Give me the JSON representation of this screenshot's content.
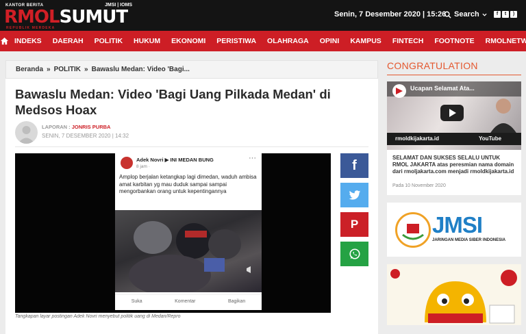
{
  "header": {
    "kantor_label": "KANTOR BERITA",
    "jmsi_label": "JMSI | IOMS",
    "logo_red": "RMOL",
    "logo_white": "SUMUT",
    "tagline": "REPUBLIK MERDEKA",
    "datetime": "Senin, 7 Desember 2020 | 15:26",
    "search_label": "Search"
  },
  "nav": {
    "items": [
      "INDEKS",
      "DAERAH",
      "POLITIK",
      "HUKUM",
      "EKONOMI",
      "PERISTIWA",
      "OLAHRAGA",
      "OPINI",
      "KAMPUS",
      "FINTECH",
      "FOOTNOTE",
      "RMOLNETWORK"
    ]
  },
  "breadcrumb": {
    "home": "Beranda",
    "section": "POLITIK",
    "current": "Bawaslu Medan: Video 'Bagi..."
  },
  "article": {
    "title": "Bawaslu Medan: Video 'Bagi Uang Pilkada Medan' di Medsos Hoax",
    "reporter_label": "LAPORAN :",
    "reporter": "JONRIS PURBA",
    "date": "SENIN, 7 DESEMBER 2020 | 14:32",
    "caption": "Tangkapan layar postingan Adek Novri menyebut politik uang di Medan/Repro"
  },
  "post": {
    "name": "Adek Novri ▶ INI MEDAN BUNG",
    "time": "8 jam ·",
    "text": "Amplop berjalan ketangkap lagi dimedan, waduh ambisa amat karbitan yg mau duduk sampai sampai mengorbankan orang untuk kepentingannya",
    "like": "Suka",
    "comment": "Komentar",
    "share": "Bagikan"
  },
  "share_buttons": {
    "facebook": "f",
    "pinterest": "P"
  },
  "sidebar": {
    "heading": "CONGRATULATION",
    "video_title": "Ucapan Selamat Ata...",
    "video_url": "rmoldkijakarta.id",
    "video_brand": "YouTube",
    "congrats_text": "SELAMAT DAN SUKSES SELALU UNTUK RMOL JAKARTA atas peresmian nama domain dari rmoljakarta.com menjadi rmoldkijakarta.id",
    "congrats_date": "Pada 10 November 2020",
    "jmsi_logo": "JMSI",
    "jmsi_sub": "JARINGAN MEDIA SIBER INDONESIA"
  },
  "colors": {
    "brand_red": "#cd1e25",
    "header_bg": "#141414",
    "sidebar_accent": "#e4572e",
    "facebook": "#3b5998",
    "twitter": "#55acee",
    "pinterest": "#cb2027",
    "whatsapp": "#25a244"
  }
}
